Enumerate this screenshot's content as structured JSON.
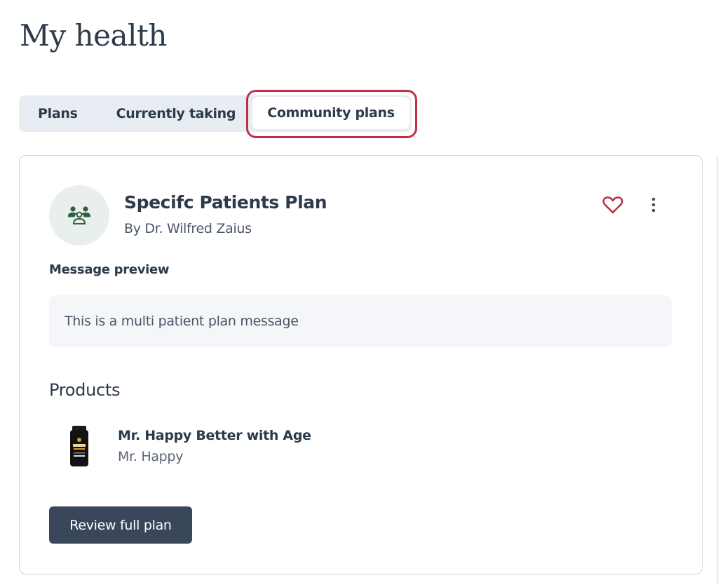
{
  "page": {
    "title": "My health"
  },
  "tabs": [
    {
      "label": "Plans",
      "active": false
    },
    {
      "label": "Currently taking",
      "active": false
    },
    {
      "label": "Community plans",
      "active": true
    }
  ],
  "plan_card": {
    "avatar_icon": "group-users-icon",
    "title": "Specifc Patients Plan",
    "author": "By Dr. Wilfred Zaius",
    "favorite_icon": "heart-outline-icon",
    "more_icon": "more-vertical-icon",
    "message_label": "Message preview",
    "message_text": "This is a multi patient plan message",
    "products_heading": "Products",
    "products": [
      {
        "name": "Mr. Happy Better with Age",
        "brand": "Mr. Happy",
        "image": "supplement-bottle"
      }
    ],
    "review_button_label": "Review full plan"
  },
  "colors": {
    "accent_highlight": "#c0304a",
    "heart": "#b83247",
    "avatar_icon": "#2f5d3f",
    "primary_button": "#3a4659",
    "text_primary": "#2d3a4a"
  }
}
